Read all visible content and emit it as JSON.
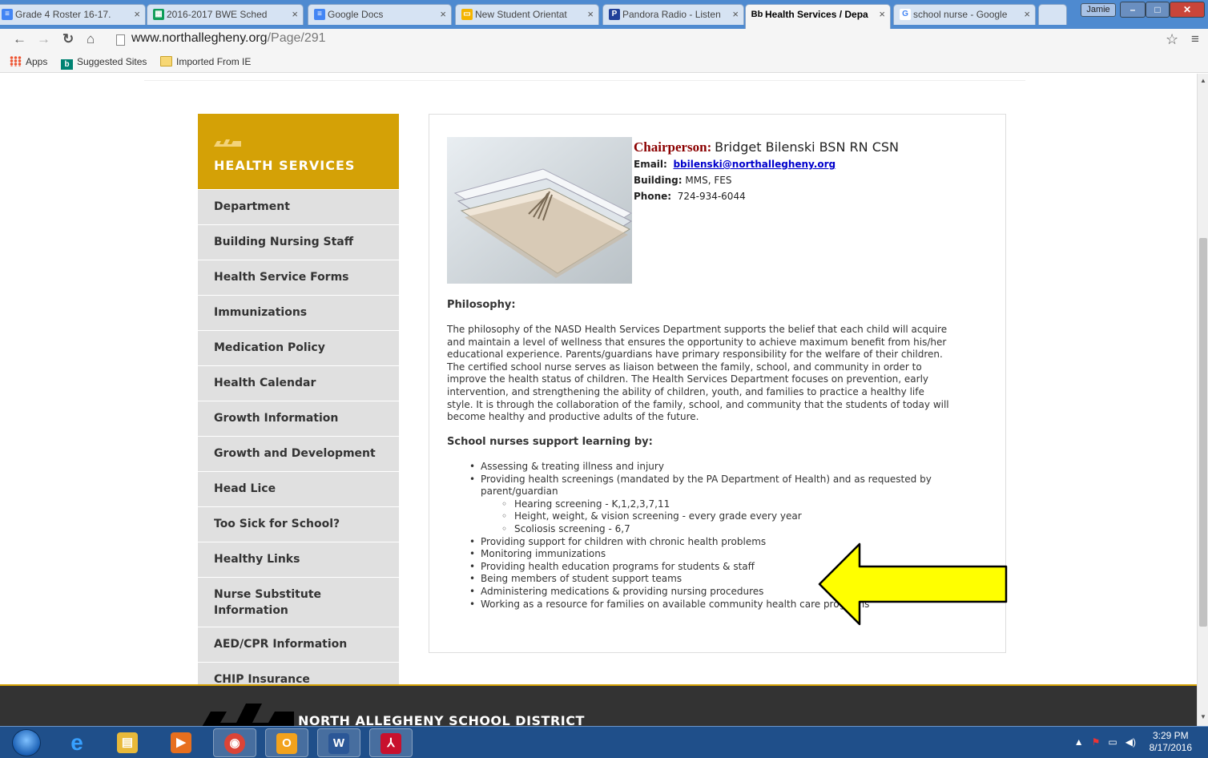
{
  "browser": {
    "tabs": [
      {
        "title": "Grade 4 Roster 16-17.",
        "favicon": "docs-icon",
        "color": "#4285f4"
      },
      {
        "title": "2016-2017 BWE Sched",
        "favicon": "sheets-icon",
        "color": "#0f9d58"
      },
      {
        "title": "Google Docs",
        "favicon": "docs-icon",
        "color": "#4285f4"
      },
      {
        "title": "New Student Orientat",
        "favicon": "slides-icon",
        "color": "#f4b400"
      },
      {
        "title": "Pandora Radio - Listen",
        "favicon": "pandora-icon",
        "color": "#224099",
        "glyph": "P"
      },
      {
        "title": "Health Services / Depa",
        "favicon": "blackboard-icon",
        "color": "#000000",
        "glyph": "Bb"
      },
      {
        "title": "school nurse - Google",
        "favicon": "google-icon",
        "color": "#4285f4",
        "glyph": "G"
      }
    ],
    "tab_close_glyph": "×",
    "user_chip": "Jamie",
    "url_host": "www.northallegheny.org",
    "url_path": "/Page/291",
    "bookmarks": [
      {
        "label": "Apps",
        "icon": "apps-grid-icon"
      },
      {
        "label": "Suggested Sites",
        "icon": "bing-icon"
      },
      {
        "label": "Imported From IE",
        "icon": "folder-icon"
      }
    ]
  },
  "sidebar": {
    "title": "HEALTH SERVICES",
    "items": [
      {
        "label": "Department"
      },
      {
        "label": "Building Nursing Staff"
      },
      {
        "label": "Health Service Forms"
      },
      {
        "label": "Immunizations"
      },
      {
        "label": "Medication Policy"
      },
      {
        "label": "Health Calendar"
      },
      {
        "label": "Growth Information"
      },
      {
        "label": "Growth and Development"
      },
      {
        "label": "Head Lice"
      },
      {
        "label": "Too Sick for School?"
      },
      {
        "label": "Healthy Links"
      },
      {
        "label": "Nurse Substitute Information"
      },
      {
        "label": "AED/CPR Information"
      },
      {
        "label": "CHIP Insurance"
      }
    ]
  },
  "content": {
    "role_label": "Chairperson:",
    "person_name": "Bridget Bilenski BSN RN CSN",
    "email_label": "Email:",
    "email": "bbilenski@northallegheny.org",
    "building_label": "Building:",
    "building": "MMS, FES",
    "phone_label": "Phone:",
    "phone": "724-934-6044",
    "philosophy_title": "Philosophy:",
    "philosophy_text": "The philosophy of the NASD Health Services Department supports the belief that each child will acquire and maintain a level of wellness that ensures the opportunity to achieve maximum benefit from his/her educational experience. Parents/guardians have primary responsibility for the welfare of their children. The certified school nurse serves as liaison between the family, school, and community in order to improve the health status of children. The Health Services Department focuses on prevention, early intervention, and strengthening the ability of children, youth, and families to practice a healthy life style. It is through the collaboration of the family, school, and community that the students of today will become healthy and productive adults of the future.",
    "support_title": "School nurses support learning by:",
    "support_list": [
      {
        "text": "Assessing & treating illness and injury",
        "level": 1
      },
      {
        "text": "Providing health screenings  (mandated by the PA Department of Health) and as requested by parent/guardian",
        "level": 1
      },
      {
        "text": "Hearing screening - K,1,2,3,7,11",
        "level": 2
      },
      {
        "text": "Height, weight, & vision screening - every grade every year",
        "level": 2
      },
      {
        "text": "Scoliosis screening - 6,7",
        "level": 2
      },
      {
        "text": "Providing support for children with chronic health problems",
        "level": 1
      },
      {
        "text": "Monitoring immunizations",
        "level": 1
      },
      {
        "text": "Providing health education programs for students & staff",
        "level": 1
      },
      {
        "text": "Being members of student support teams",
        "level": 1
      },
      {
        "text": "Administering medications & providing nursing procedures",
        "level": 1
      },
      {
        "text": "Working as a resource for families on available community health care programs",
        "level": 1
      }
    ]
  },
  "footer": {
    "title": "NORTH ALLEGHENY SCHOOL DISTRICT"
  },
  "taskbar": {
    "apps": [
      {
        "name": "internet-explorer-icon",
        "glyph": "e",
        "color": "#1e90ff"
      },
      {
        "name": "file-explorer-icon",
        "glyph": "▤",
        "color": "#e8b93a"
      },
      {
        "name": "media-player-icon",
        "glyph": "▶",
        "color": "#e76f1e"
      },
      {
        "name": "chrome-icon",
        "glyph": "◉",
        "color": "#db4437"
      },
      {
        "name": "outlook-icon",
        "glyph": "O",
        "color": "#f2a21d"
      },
      {
        "name": "word-icon",
        "glyph": "W",
        "color": "#2b5797"
      },
      {
        "name": "acrobat-icon",
        "glyph": "⅄",
        "color": "#c8102e"
      }
    ],
    "time": "3:29 PM",
    "date": "8/17/2016"
  },
  "colors": {
    "accent_gold": "#d4a106",
    "chairperson_red": "#8b0000",
    "annotation_arrow": "#ffff00"
  }
}
